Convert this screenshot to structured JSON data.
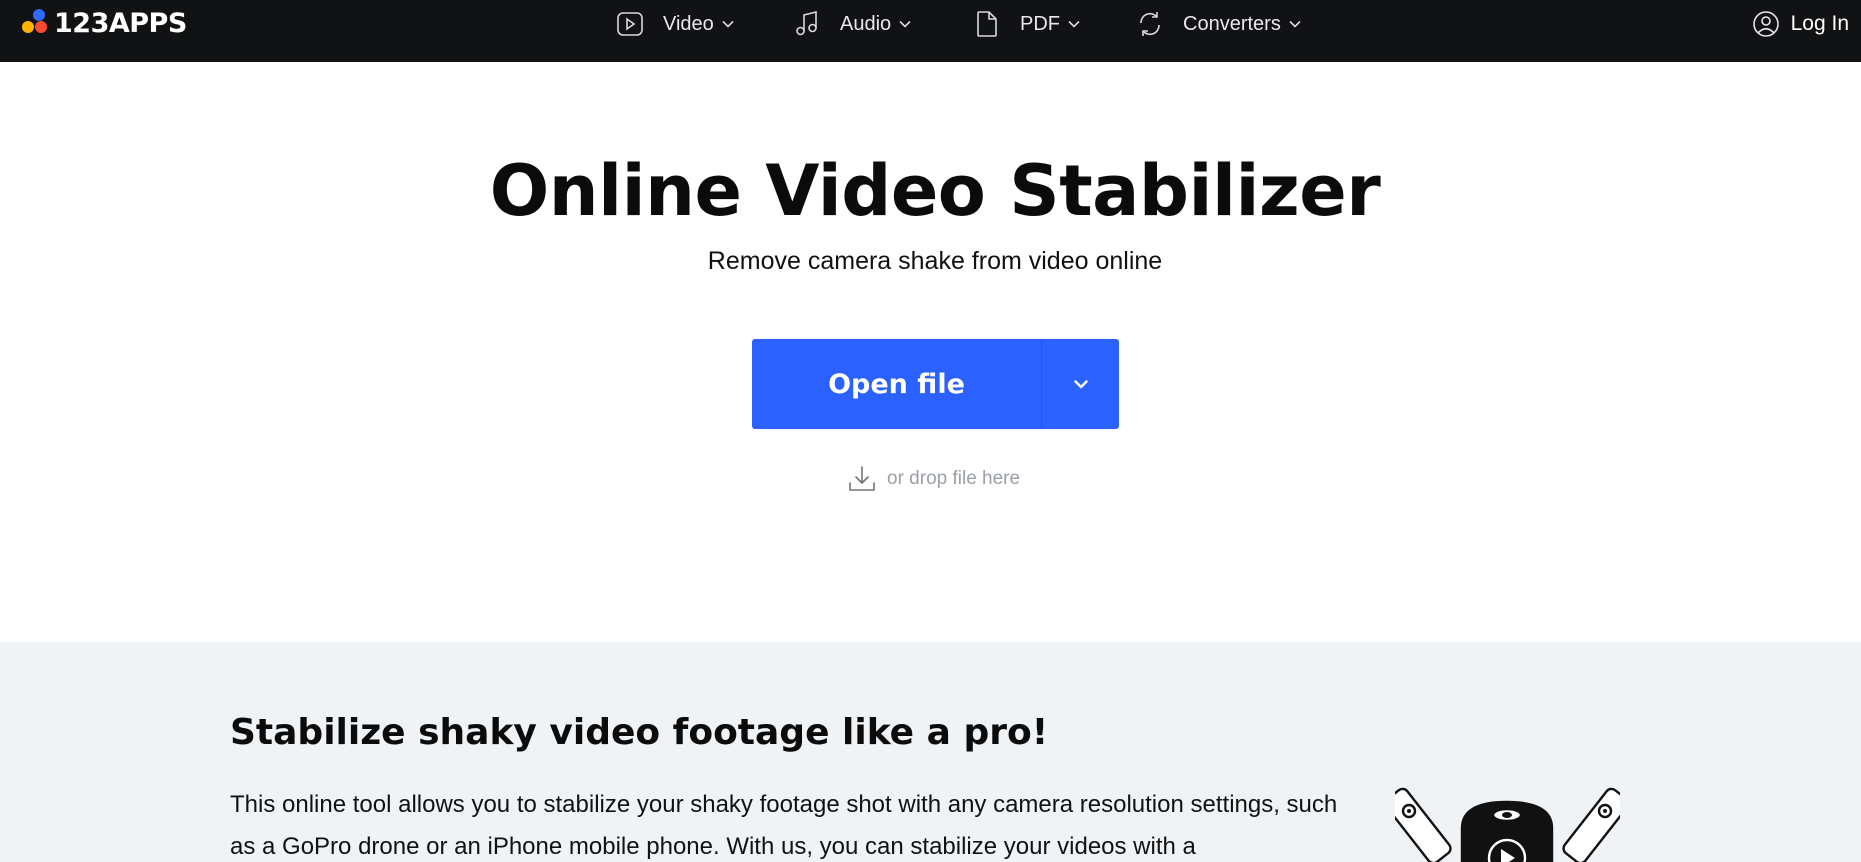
{
  "brand": {
    "name": "123APPS"
  },
  "nav": {
    "items": [
      {
        "label": "Video",
        "icon": "play-icon"
      },
      {
        "label": "Audio",
        "icon": "music-note-icon"
      },
      {
        "label": "PDF",
        "icon": "file-icon"
      },
      {
        "label": "Converters",
        "icon": "refresh-icon"
      }
    ],
    "login_label": "Log In"
  },
  "hero": {
    "title": "Online Video Stabilizer",
    "subtitle": "Remove camera shake from video online",
    "open_file_label": "Open file",
    "drop_hint": "or drop file here"
  },
  "info": {
    "title": "Stabilize shaky video footage like a pro!",
    "body": "This online tool allows you to stabilize your shaky footage shot with any camera resolution settings, such as a GoPro drone or an iPhone mobile phone. With us, you can stabilize your videos with a"
  },
  "colors": {
    "nav_bg": "#111214",
    "accent": "#2b62ff",
    "section_bg": "#f0f3f6",
    "logo_dot_blue": "#2f6bff",
    "logo_dot_yellow": "#ffb400",
    "logo_dot_red": "#ff4a2f"
  }
}
